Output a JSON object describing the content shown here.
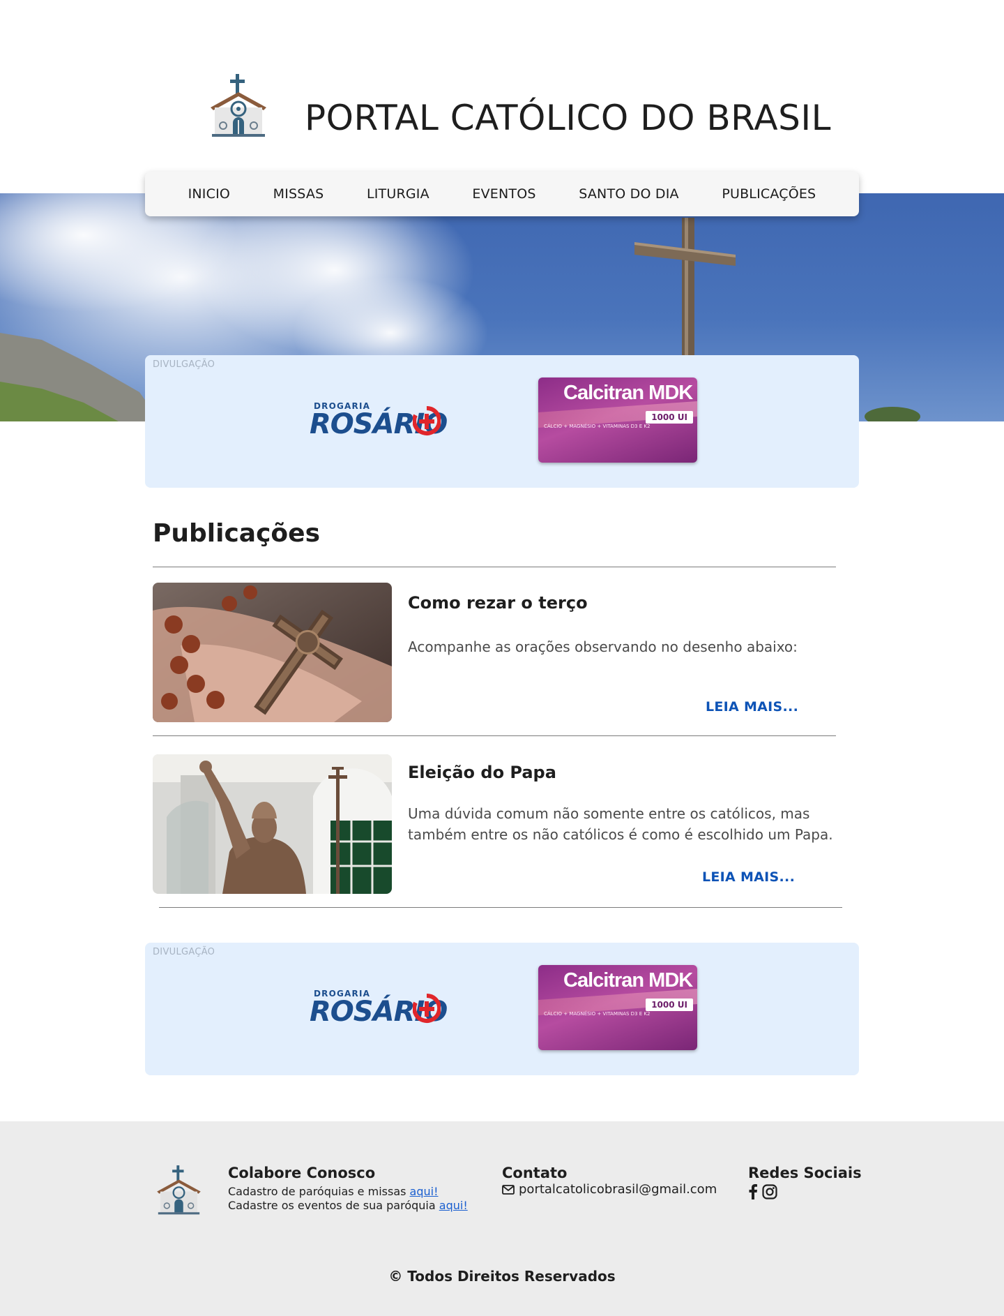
{
  "site": {
    "title": "PORTAL CATÓLICO DO BRASIL",
    "logo_icon": "church-icon"
  },
  "nav": {
    "items": [
      {
        "label": "INICIO"
      },
      {
        "label": "MISSAS"
      },
      {
        "label": "LITURGIA"
      },
      {
        "label": "EVENTOS"
      },
      {
        "label": "SANTO DO DIA"
      },
      {
        "label": "PUBLICAÇÕES"
      }
    ]
  },
  "hero": {
    "image": "cross-on-mountain-sky"
  },
  "ads": [
    {
      "label": "DIVULGAÇÃO",
      "brand_pre": "DROGARIA",
      "brand_name": "ROSÁRIO",
      "product_name": "Calcitran MDK",
      "product_dose": "1000 UI",
      "product_note": "CÁLCIO + MAGNÉSIO + VITAMINAS D3 E K2"
    },
    {
      "label": "DIVULGAÇÃO",
      "brand_pre": "DROGARIA",
      "brand_name": "ROSÁRIO",
      "product_name": "Calcitran MDK",
      "product_dose": "1000 UI",
      "product_note": "CÁLCIO + MAGNÉSIO + VITAMINAS D3 E K2"
    }
  ],
  "publications": {
    "title": "Publicações",
    "posts": [
      {
        "title": "Como rezar o terço",
        "text": "Acompanhe as orações observando no desenho abaixo:",
        "more": "LEIA MAIS...",
        "image": "rosary-in-hand"
      },
      {
        "title": "Eleição do Papa",
        "text": "Uma dúvida comum não somente entre os católicos, mas também entre os não católicos é como é escolhido um Papa.",
        "more": "LEIA MAIS...",
        "image": "pope-statue"
      }
    ]
  },
  "footer": {
    "colabore": {
      "title": "Colabore Conosco",
      "line1": "Cadastro de paróquias e missas",
      "line2": "Cadastre os eventos de sua paróquia",
      "link": "aqui!"
    },
    "contato": {
      "title": "Contato",
      "email": "portalcatolicobrasil@gmail.com",
      "icon": "mail-icon"
    },
    "redes": {
      "title": "Redes Sociais",
      "icons": [
        "facebook-icon",
        "instagram-icon"
      ]
    },
    "copyright": "© Todos Direitos Reservados"
  },
  "colors": {
    "nav_bg": "#f6f6f6",
    "ad_bg": "#e3effd",
    "link": "#0d53b6",
    "footer_bg": "#ececec",
    "sky": "#4a74bb"
  }
}
